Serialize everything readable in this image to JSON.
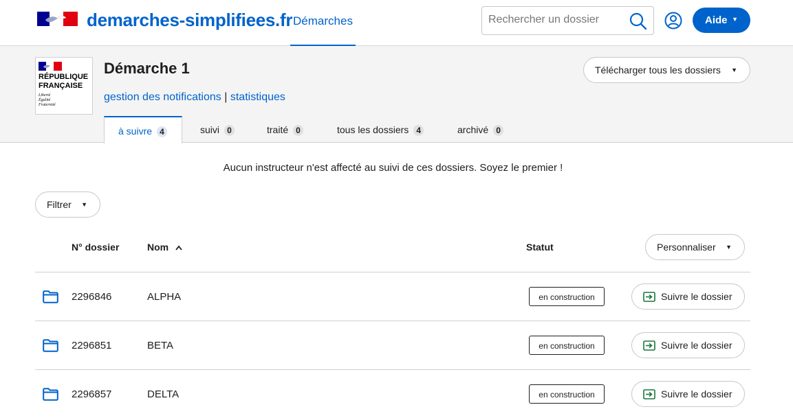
{
  "header": {
    "brand": "demarches-simplifiees.fr",
    "nav_demarches": "Démarches",
    "search_placeholder": "Rechercher un dossier",
    "aide_label": "Aide"
  },
  "procedure": {
    "logo_lines": [
      "RÉPUBLIQUE",
      "FRANÇAISE"
    ],
    "logo_motto": [
      "Liberté",
      "Égalité",
      "Fraternité"
    ],
    "title": "Démarche 1",
    "link_notifications": "gestion des notifications",
    "link_separator": "|",
    "link_statistiques": "statistiques",
    "download_label": "Télécharger tous les dossiers"
  },
  "tabs": [
    {
      "label": "à suivre",
      "count": "4",
      "active": true
    },
    {
      "label": "suivi",
      "count": "0",
      "active": false
    },
    {
      "label": "traité",
      "count": "0",
      "active": false
    },
    {
      "label": "tous les dossiers",
      "count": "4",
      "active": false
    },
    {
      "label": "archivé",
      "count": "0",
      "active": false
    }
  ],
  "notice": "Aucun instructeur n'est affecté au suivi de ces dossiers. Soyez le premier !",
  "filter_label": "Filtrer",
  "table": {
    "headers": {
      "num": "N° dossier",
      "nom": "Nom",
      "statut": "Statut"
    },
    "personnaliser_label": "Personnaliser",
    "rows": [
      {
        "num": "2296846",
        "nom": "ALPHA",
        "statut": "en construction",
        "action": "Suivre le dossier"
      },
      {
        "num": "2296851",
        "nom": "BETA",
        "statut": "en construction",
        "action": "Suivre le dossier"
      },
      {
        "num": "2296857",
        "nom": "DELTA",
        "statut": "en construction",
        "action": "Suivre le dossier"
      }
    ]
  },
  "colors": {
    "accent": "#0063cb",
    "flag_blue": "#000091",
    "flag_red": "#e1000f",
    "follow_green": "#18753c"
  }
}
